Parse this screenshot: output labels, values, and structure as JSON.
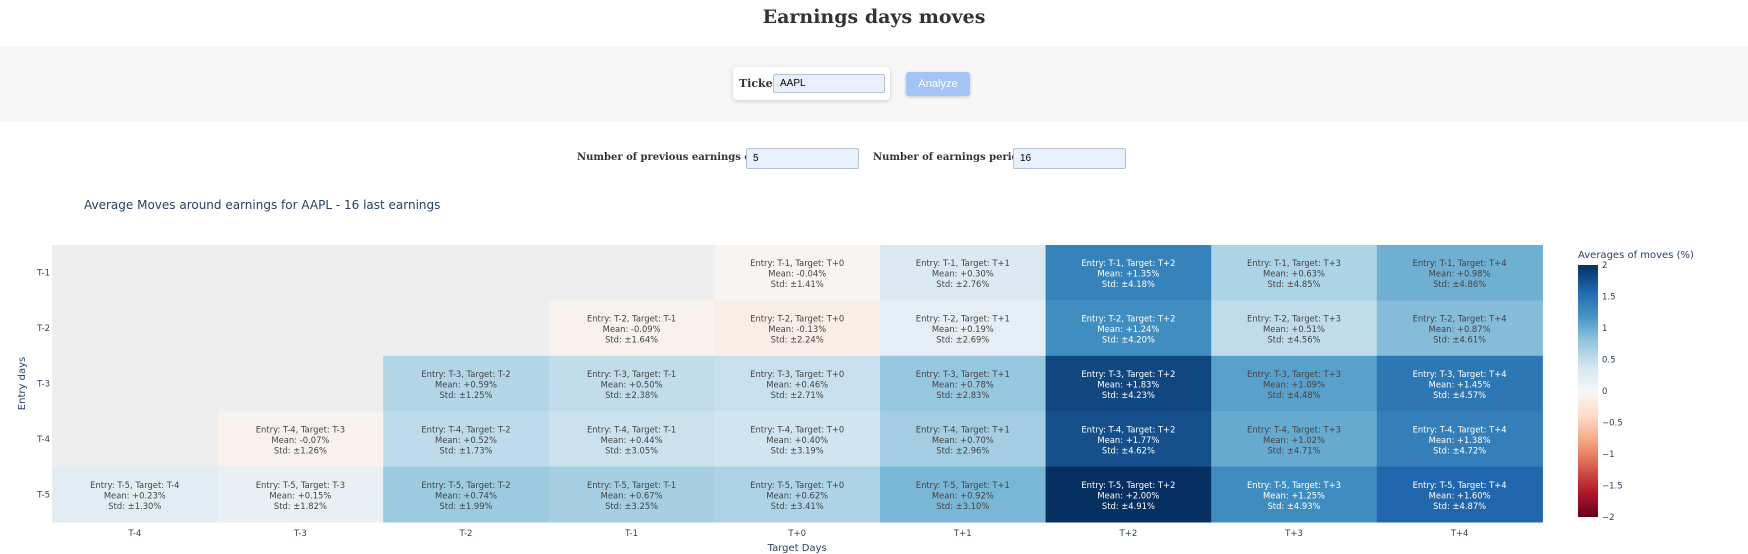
{
  "header": {
    "title": "Earnings days moves"
  },
  "ticker": {
    "label": "Ticker:",
    "value": "AAPL"
  },
  "analyze": {
    "label": "Analyze"
  },
  "params": {
    "prev_days_label": "Number of previous earnings days :",
    "prev_days_value": "5",
    "periods_label": "Number of earnings periods :",
    "periods_value": "16"
  },
  "chart_data": {
    "type": "heatmap",
    "title": "Average Moves around earnings for AAPL - 16 last earnings",
    "xlabel": "Target Days",
    "ylabel": "Entry days",
    "x": [
      "T-4",
      "T-3",
      "T-2",
      "T-1",
      "T+0",
      "T+1",
      "T+2",
      "T+3",
      "T+4"
    ],
    "y": [
      "T-1",
      "T-2",
      "T-3",
      "T-4",
      "T-5"
    ],
    "colorbar": {
      "title": "Averages of moves (%)",
      "range": [
        -2,
        2
      ],
      "ticks": [
        "2",
        "1.5",
        "1",
        "0.5",
        "0",
        "−0.5",
        "−1",
        "−1.5",
        "−2"
      ],
      "tick_values": [
        2,
        1.5,
        1,
        0.5,
        0,
        -0.5,
        -1,
        -1.5,
        -2
      ],
      "colorscale": "RdBu",
      "stops": [
        "#67001f",
        "#b2182b",
        "#d6604d",
        "#f4a582",
        "#fddbc7",
        "#f7f7f7",
        "#d1e5f0",
        "#92c5de",
        "#4393c3",
        "#2166ac",
        "#053061"
      ]
    },
    "missing_color": "#eeeeee",
    "cells": [
      [
        null,
        null,
        null,
        null,
        {
          "label": "Entry: T-1, Target: T+0",
          "mean": -0.04,
          "mean_text": "Mean: -0.04%",
          "std_text": "Std: ±1.41%"
        },
        {
          "label": "Entry: T-1, Target: T+1",
          "mean": 0.3,
          "mean_text": "Mean: +0.30%",
          "std_text": "Std: ±2.76%"
        },
        {
          "label": "Entry: T-1, Target: T+2",
          "mean": 1.35,
          "mean_text": "Mean: +1.35%",
          "std_text": "Std: ±4.18%"
        },
        {
          "label": "Entry: T-1, Target: T+3",
          "mean": 0.63,
          "mean_text": "Mean: +0.63%",
          "std_text": "Std: ±4.85%"
        },
        {
          "label": "Entry: T-1, Target: T+4",
          "mean": 0.98,
          "mean_text": "Mean: +0.98%",
          "std_text": "Std: ±4.86%"
        }
      ],
      [
        null,
        null,
        null,
        {
          "label": "Entry: T-2, Target: T-1",
          "mean": -0.09,
          "mean_text": "Mean: -0.09%",
          "std_text": "Std: ±1.64%"
        },
        {
          "label": "Entry: T-2, Target: T+0",
          "mean": -0.13,
          "mean_text": "Mean: -0.13%",
          "std_text": "Std: ±2.24%"
        },
        {
          "label": "Entry: T-2, Target: T+1",
          "mean": 0.19,
          "mean_text": "Mean: +0.19%",
          "std_text": "Std: ±2.69%"
        },
        {
          "label": "Entry: T-2, Target: T+2",
          "mean": 1.24,
          "mean_text": "Mean: +1.24%",
          "std_text": "Std: ±4.20%"
        },
        {
          "label": "Entry: T-2, Target: T+3",
          "mean": 0.51,
          "mean_text": "Mean: +0.51%",
          "std_text": "Std: ±4.56%"
        },
        {
          "label": "Entry: T-2, Target: T+4",
          "mean": 0.87,
          "mean_text": "Mean: +0.87%",
          "std_text": "Std: ±4.61%"
        }
      ],
      [
        null,
        null,
        {
          "label": "Entry: T-3, Target: T-2",
          "mean": 0.59,
          "mean_text": "Mean: +0.59%",
          "std_text": "Std: ±1.25%"
        },
        {
          "label": "Entry: T-3, Target: T-1",
          "mean": 0.5,
          "mean_text": "Mean: +0.50%",
          "std_text": "Std: ±2.38%"
        },
        {
          "label": "Entry: T-3, Target: T+0",
          "mean": 0.46,
          "mean_text": "Mean: +0.46%",
          "std_text": "Std: ±2.71%"
        },
        {
          "label": "Entry: T-3, Target: T+1",
          "mean": 0.78,
          "mean_text": "Mean: +0.78%",
          "std_text": "Std: ±2.83%"
        },
        {
          "label": "Entry: T-3, Target: T+2",
          "mean": 1.83,
          "mean_text": "Mean: +1.83%",
          "std_text": "Std: ±4.23%"
        },
        {
          "label": "Entry: T-3, Target: T+3",
          "mean": 1.09,
          "mean_text": "Mean: +1.09%",
          "std_text": "Std: ±4.48%"
        },
        {
          "label": "Entry: T-3, Target: T+4",
          "mean": 1.45,
          "mean_text": "Mean: +1.45%",
          "std_text": "Std: ±4.57%"
        }
      ],
      [
        null,
        {
          "label": "Entry: T-4, Target: T-3",
          "mean": -0.07,
          "mean_text": "Mean: -0.07%",
          "std_text": "Std: ±1.26%"
        },
        {
          "label": "Entry: T-4, Target: T-2",
          "mean": 0.52,
          "mean_text": "Mean: +0.52%",
          "std_text": "Std: ±1.73%"
        },
        {
          "label": "Entry: T-4, Target: T-1",
          "mean": 0.44,
          "mean_text": "Mean: +0.44%",
          "std_text": "Std: ±3.05%"
        },
        {
          "label": "Entry: T-4, Target: T+0",
          "mean": 0.4,
          "mean_text": "Mean: +0.40%",
          "std_text": "Std: ±3.19%"
        },
        {
          "label": "Entry: T-4, Target: T+1",
          "mean": 0.7,
          "mean_text": "Mean: +0.70%",
          "std_text": "Std: ±2.96%"
        },
        {
          "label": "Entry: T-4, Target: T+2",
          "mean": 1.77,
          "mean_text": "Mean: +1.77%",
          "std_text": "Std: ±4.62%"
        },
        {
          "label": "Entry: T-4, Target: T+3",
          "mean": 1.02,
          "mean_text": "Mean: +1.02%",
          "std_text": "Std: ±4.71%"
        },
        {
          "label": "Entry: T-4, Target: T+4",
          "mean": 1.38,
          "mean_text": "Mean: +1.38%",
          "std_text": "Std: ±4.72%"
        }
      ],
      [
        {
          "label": "Entry: T-5, Target: T-4",
          "mean": 0.23,
          "mean_text": "Mean: +0.23%",
          "std_text": "Std: ±1.30%"
        },
        {
          "label": "Entry: T-5, Target: T-3",
          "mean": 0.15,
          "mean_text": "Mean: +0.15%",
          "std_text": "Std: ±1.82%"
        },
        {
          "label": "Entry: T-5, Target: T-2",
          "mean": 0.74,
          "mean_text": "Mean: +0.74%",
          "std_text": "Std: ±1.99%"
        },
        {
          "label": "Entry: T-5, Target: T-1",
          "mean": 0.67,
          "mean_text": "Mean: +0.67%",
          "std_text": "Std: ±3.25%"
        },
        {
          "label": "Entry: T-5, Target: T+0",
          "mean": 0.62,
          "mean_text": "Mean: +0.62%",
          "std_text": "Std: ±3.41%"
        },
        {
          "label": "Entry: T-5, Target: T+1",
          "mean": 0.92,
          "mean_text": "Mean: +0.92%",
          "std_text": "Std: ±3.10%"
        },
        {
          "label": "Entry: T-5, Target: T+2",
          "mean": 2.0,
          "mean_text": "Mean: +2.00%",
          "std_text": "Std: ±4.91%"
        },
        {
          "label": "Entry: T-5, Target: T+3",
          "mean": 1.25,
          "mean_text": "Mean: +1.25%",
          "std_text": "Std: ±4.93%"
        },
        {
          "label": "Entry: T-5, Target: T+4",
          "mean": 1.6,
          "mean_text": "Mean: +1.60%",
          "std_text": "Std: ±4.87%"
        }
      ]
    ]
  }
}
